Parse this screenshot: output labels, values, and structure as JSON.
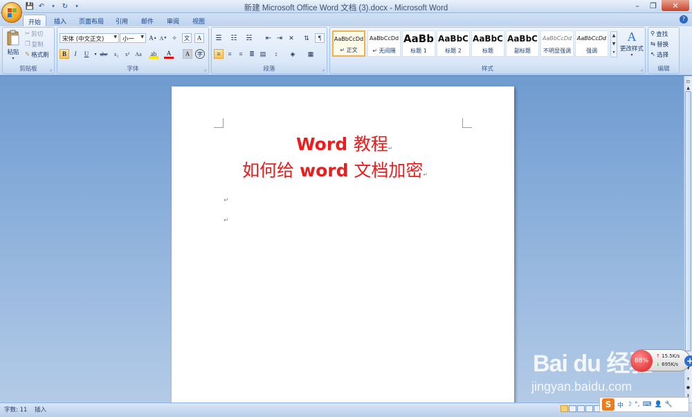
{
  "window": {
    "title": "新建 Microsoft Office Word 文档 (3).docx - Microsoft Word",
    "controls": [
      "–",
      "❐",
      "✕"
    ]
  },
  "tabs": [
    "开始",
    "插入",
    "页面布局",
    "引用",
    "邮件",
    "审阅",
    "视图"
  ],
  "ribbon": {
    "clipboard": {
      "title": "剪贴板",
      "paste": "粘贴",
      "cut": "剪切",
      "copy": "复制",
      "format_painter": "格式刷"
    },
    "font": {
      "title": "字体",
      "font_name": "宋体 (中文正文)",
      "font_size": "小一"
    },
    "paragraph": {
      "title": "段落"
    },
    "styles": {
      "title": "样式",
      "items": [
        {
          "sample": "AaBbCcDd",
          "name": "↵ 正文"
        },
        {
          "sample": "AaBbCcDd",
          "name": "↵ 无间隔"
        },
        {
          "sample": "AaBb",
          "name": "标题 1"
        },
        {
          "sample": "AaBbC",
          "name": "标题 2"
        },
        {
          "sample": "AaBbC",
          "name": "标题"
        },
        {
          "sample": "AaBbC",
          "name": "副标题"
        },
        {
          "sample": "AaBbCcDd",
          "name": "不明显强调"
        },
        {
          "sample": "AaBbCcDd",
          "name": "强调"
        }
      ],
      "change_styles": "更改样式"
    },
    "editing": {
      "title": "编辑",
      "find": "查找",
      "replace": "替换",
      "select": "选择"
    }
  },
  "document": {
    "line1_latin": "Word",
    "line1_cjk": "教程",
    "line2_cjk_a": "如何给",
    "line2_latin": "word",
    "line2_cjk_b": "文档加密",
    "paragraph_mark": "↵",
    "text_color": "#ee1c1c"
  },
  "statusbar": {
    "word_count": "字数: 11",
    "mode": "插入"
  },
  "overlays": {
    "watermark_brand": "Bai du 经验",
    "watermark_url": "jingyan.baidu.com",
    "net_percent": "88%",
    "net_up": "15.5K/s",
    "net_down": "695K/s",
    "ime_label": "中"
  }
}
